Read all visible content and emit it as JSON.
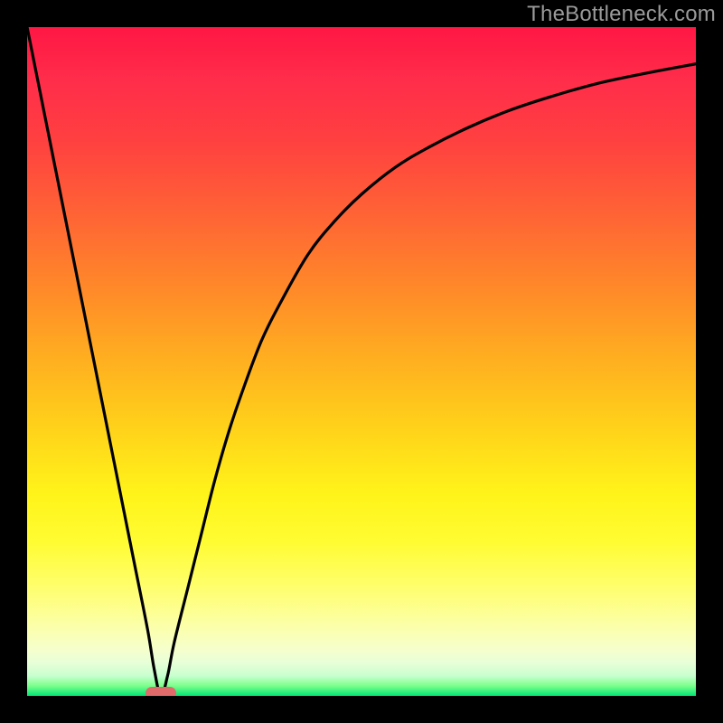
{
  "watermark": "TheBottleneck.com",
  "chart_data": {
    "type": "line",
    "title": "",
    "xlabel": "",
    "ylabel": "",
    "xlim": [
      0,
      100
    ],
    "ylim": [
      0,
      100
    ],
    "grid": false,
    "series": [
      {
        "name": "bottleneck-curve",
        "x": [
          0,
          2,
          4,
          6,
          8,
          10,
          12,
          14,
          16,
          18,
          19,
          20,
          21,
          22,
          24,
          26,
          28,
          30,
          32,
          35,
          38,
          42,
          46,
          50,
          55,
          60,
          66,
          72,
          78,
          85,
          92,
          100
        ],
        "y": [
          100,
          90,
          80,
          70,
          60,
          50,
          40,
          30,
          20,
          10,
          4,
          0,
          3,
          8,
          16,
          24,
          32,
          39,
          45,
          53,
          59,
          66,
          71,
          75,
          79,
          82,
          85,
          87.5,
          89.5,
          91.5,
          93,
          94.5
        ]
      }
    ],
    "marker": {
      "x": 20,
      "y": 0,
      "color": "#e06a6a"
    },
    "background_gradient": {
      "stops": [
        {
          "pos": 0,
          "color": "#ff1744"
        },
        {
          "pos": 50,
          "color": "#ffd21a"
        },
        {
          "pos": 100,
          "color": "#00e676"
        }
      ]
    }
  }
}
